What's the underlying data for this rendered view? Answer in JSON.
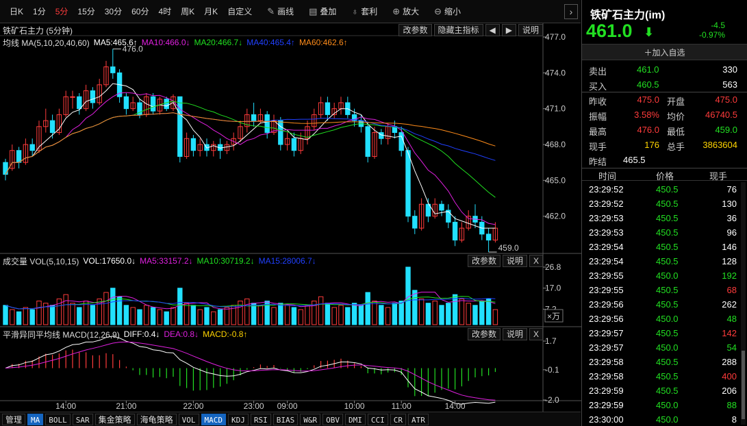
{
  "toolbar": {
    "periods": [
      "日K",
      "1分",
      "5分",
      "15分",
      "30分",
      "60分",
      "4时",
      "周K",
      "月K",
      "自定义"
    ],
    "active_period": "5分",
    "tools": [
      {
        "name": "draw",
        "icon": "pen-icon",
        "label": "画线"
      },
      {
        "name": "overlay",
        "icon": "stack-icon",
        "label": "叠加"
      },
      {
        "name": "arbitrage",
        "icon": "money-bag-icon",
        "label": "套利"
      },
      {
        "name": "zoom-in",
        "icon": "zoom-in-icon",
        "label": "放大"
      },
      {
        "name": "zoom-out",
        "icon": "zoom-out-icon",
        "label": "缩小"
      }
    ]
  },
  "main_panel": {
    "title": "铁矿石主力 (5分钟)",
    "ma_prefix": "均线 MA(5,10,20,40,60)",
    "ma_values": [
      {
        "label": "MA5:465.6↑",
        "color": "#ffffff"
      },
      {
        "label": "MA10:466.0↓",
        "color": "#e020e0"
      },
      {
        "label": "MA20:466.7↓",
        "color": "#20e020"
      },
      {
        "label": "MA40:465.4↑",
        "color": "#2040ff"
      },
      {
        "label": "MA60:462.6↑",
        "color": "#ff8c1a"
      }
    ],
    "buttons": [
      "改参数",
      "隐藏主指标",
      "◀",
      "▶",
      "说明"
    ],
    "y_ticks": [
      "477.0",
      "474.0",
      "471.0",
      "468.0",
      "465.0",
      "462.0"
    ],
    "high_label": "476.0",
    "low_label": "459.0"
  },
  "volume_panel": {
    "title": "成交量 VOL(5,10,15)",
    "values": [
      {
        "label": "VOL:17650.0↓",
        "color": "#ffffff"
      },
      {
        "label": "MA5:33157.2↓",
        "color": "#e020e0"
      },
      {
        "label": "MA10:30719.2↓",
        "color": "#20e020"
      },
      {
        "label": "MA15:28006.7↓",
        "color": "#2040ff"
      }
    ],
    "buttons": [
      "改参数",
      "说明",
      "X"
    ],
    "y_ticks": [
      "26.8",
      "17.0",
      "7.2"
    ],
    "unit": "×万"
  },
  "macd_panel": {
    "title": "平滑异同平均线 MACD(12,26,9)",
    "values": [
      {
        "label": "DIFF:0.4↓",
        "color": "#ffffff"
      },
      {
        "label": "DEA:0.8↓",
        "color": "#e020e0"
      },
      {
        "label": "MACD:-0.8↑",
        "color": "#ffd400"
      }
    ],
    "buttons": [
      "改参数",
      "说明",
      "X"
    ],
    "y_ticks": [
      "1.7",
      "-0.1",
      "-2.0"
    ]
  },
  "x_axis": [
    "14:00",
    "21:00",
    "22:00",
    "23:00",
    "09:00",
    "10:00",
    "11:00",
    "14:00"
  ],
  "bottom_tabs": [
    "管理",
    "MA",
    "BOLL",
    "SAR",
    "集金策略",
    "海龟策略",
    "VOL",
    "MACD",
    "KDJ",
    "RSI",
    "BIAS",
    "W&R",
    "OBV",
    "DMI",
    "CCI",
    "CR",
    "ATR"
  ],
  "active_tabs": [
    "MA",
    "MACD"
  ],
  "quote": {
    "name": "铁矿石主力(im)",
    "price": "461.0",
    "change": "-4.5",
    "change_pct": "-0.97%",
    "watch_label": "加入自选",
    "sell_label": "卖出",
    "sell_price": "461.0",
    "sell_vol": "330",
    "buy_label": "买入",
    "buy_price": "460.5",
    "buy_vol": "563",
    "prev_close_label": "昨收",
    "prev_close": "475.0",
    "open_label": "开盘",
    "open": "475.0",
    "amp_label": "振幅",
    "amp": "3.58%",
    "avg_label": "均价",
    "avg": "46740.5",
    "high_label": "最高",
    "high": "476.0",
    "low_label": "最低",
    "low": "459.0",
    "cur_vol_label": "现手",
    "cur_vol": "176",
    "total_vol_label": "总手",
    "total_vol": "3863604",
    "prev_settle_label": "昨结",
    "prev_settle": "465.5"
  },
  "ticks_header": [
    "时间",
    "价格",
    "现手"
  ],
  "ticks": [
    {
      "time": "23:29:52",
      "price": "450.5",
      "vol": "76",
      "vc": "w"
    },
    {
      "time": "23:29:52",
      "price": "450.5",
      "vol": "130",
      "vc": "w"
    },
    {
      "time": "23:29:53",
      "price": "450.5",
      "vol": "36",
      "vc": "w"
    },
    {
      "time": "23:29:53",
      "price": "450.5",
      "vol": "96",
      "vc": "w"
    },
    {
      "time": "23:29:54",
      "price": "450.5",
      "vol": "146",
      "vc": "w"
    },
    {
      "time": "23:29:54",
      "price": "450.5",
      "vol": "128",
      "vc": "w"
    },
    {
      "time": "23:29:55",
      "price": "450.0",
      "vol": "192",
      "vc": "g"
    },
    {
      "time": "23:29:55",
      "price": "450.5",
      "vol": "68",
      "vc": "r"
    },
    {
      "time": "23:29:56",
      "price": "450.5",
      "vol": "262",
      "vc": "w"
    },
    {
      "time": "23:29:56",
      "price": "450.0",
      "vol": "48",
      "vc": "g"
    },
    {
      "time": "23:29:57",
      "price": "450.5",
      "vol": "142",
      "vc": "r"
    },
    {
      "time": "23:29:57",
      "price": "450.0",
      "vol": "54",
      "vc": "g"
    },
    {
      "time": "23:29:58",
      "price": "450.5",
      "vol": "288",
      "vc": "w"
    },
    {
      "time": "23:29:58",
      "price": "450.5",
      "vol": "400",
      "vc": "r"
    },
    {
      "time": "23:29:59",
      "price": "450.5",
      "vol": "206",
      "vc": "w"
    },
    {
      "time": "23:29:59",
      "price": "450.0",
      "vol": "88",
      "vc": "g"
    },
    {
      "time": "23:30:00",
      "price": "450.0",
      "vol": "8",
      "vc": "w"
    }
  ],
  "chart_data": {
    "type": "candlestick",
    "title": "铁矿石主力 (5分钟)",
    "candles": [
      [
        466.5,
        465.5,
        466.8,
        465.0
      ],
      [
        466.0,
        467.5,
        468.0,
        465.8
      ],
      [
        467.5,
        466.5,
        467.8,
        466.0
      ],
      [
        466.5,
        468.0,
        468.5,
        466.3
      ],
      [
        468.0,
        467.5,
        468.5,
        467.0
      ],
      [
        467.5,
        469.5,
        470.0,
        467.3
      ],
      [
        469.5,
        470.0,
        471.0,
        469.0
      ],
      [
        470.0,
        469.0,
        470.5,
        468.5
      ],
      [
        469.0,
        470.5,
        471.0,
        468.8
      ],
      [
        470.5,
        472.0,
        472.5,
        470.3
      ],
      [
        472.0,
        472.0,
        472.5,
        471.0
      ],
      [
        472.0,
        471.0,
        472.3,
        470.5
      ],
      [
        471.0,
        472.5,
        473.0,
        470.8
      ],
      [
        472.5,
        471.5,
        472.8,
        471.0
      ],
      [
        471.5,
        473.0,
        473.5,
        471.3
      ],
      [
        473.0,
        474.5,
        475.0,
        472.8
      ],
      [
        474.5,
        474.0,
        476.0,
        473.5
      ],
      [
        474.0,
        472.0,
        474.3,
        471.5
      ],
      [
        472.0,
        471.0,
        472.3,
        470.5
      ],
      [
        471.0,
        471.5,
        472.0,
        470.8
      ],
      [
        471.5,
        470.5,
        471.8,
        470.2
      ],
      [
        470.5,
        472.0,
        472.3,
        470.3
      ],
      [
        472.0,
        470.8,
        472.3,
        470.5
      ],
      [
        470.8,
        471.8,
        472.0,
        470.5
      ],
      [
        471.8,
        471.0,
        472.0,
        470.8
      ],
      [
        471.0,
        472.0,
        472.2,
        470.8
      ],
      [
        472.0,
        467.0,
        472.0,
        466.5
      ],
      [
        467.0,
        468.5,
        469.0,
        466.8
      ],
      [
        468.5,
        467.5,
        468.8,
        467.0
      ],
      [
        467.5,
        468.0,
        468.5,
        467.0
      ],
      [
        468.0,
        467.5,
        468.5,
        467.0
      ],
      [
        467.5,
        468.0,
        468.3,
        467.0
      ],
      [
        468.0,
        467.5,
        468.5,
        466.8
      ],
      [
        467.5,
        468.0,
        468.3,
        467.2
      ],
      [
        468.0,
        468.5,
        469.0,
        467.5
      ],
      [
        468.5,
        469.5,
        470.0,
        468.2
      ],
      [
        469.5,
        470.5,
        471.0,
        469.0
      ],
      [
        470.5,
        470.0,
        471.5,
        469.5
      ],
      [
        470.0,
        470.5,
        471.0,
        469.8
      ],
      [
        470.5,
        469.0,
        470.8,
        468.5
      ],
      [
        469.0,
        470.0,
        470.5,
        468.8
      ],
      [
        470.0,
        468.0,
        470.3,
        467.5
      ],
      [
        468.0,
        468.5,
        469.0,
        467.5
      ],
      [
        468.5,
        467.5,
        469.0,
        467.0
      ],
      [
        467.5,
        468.5,
        469.0,
        467.2
      ],
      [
        468.5,
        469.5,
        470.0,
        468.0
      ],
      [
        469.5,
        470.5,
        471.0,
        469.2
      ],
      [
        470.5,
        471.5,
        472.0,
        470.2
      ],
      [
        471.5,
        470.5,
        472.0,
        470.0
      ],
      [
        470.5,
        471.0,
        471.5,
        470.2
      ],
      [
        471.0,
        471.5,
        472.0,
        470.5
      ],
      [
        471.5,
        470.5,
        472.0,
        470.2
      ],
      [
        470.5,
        470.0,
        471.0,
        469.5
      ],
      [
        470.0,
        469.5,
        470.5,
        469.0
      ],
      [
        469.5,
        467.0,
        469.8,
        466.5
      ],
      [
        467.0,
        469.0,
        469.5,
        466.8
      ],
      [
        469.0,
        468.5,
        469.3,
        468.0
      ],
      [
        468.5,
        469.5,
        469.8,
        468.0
      ],
      [
        469.5,
        469.0,
        470.0,
        468.5
      ],
      [
        469.0,
        467.5,
        469.5,
        467.0
      ],
      [
        467.5,
        462.0,
        467.8,
        461.5
      ],
      [
        462.0,
        461.0,
        462.5,
        460.5
      ],
      [
        461.0,
        463.0,
        463.5,
        460.8
      ],
      [
        463.0,
        462.0,
        463.5,
        461.5
      ],
      [
        462.0,
        463.0,
        463.5,
        461.8
      ],
      [
        463.0,
        462.5,
        463.3,
        462.0
      ],
      [
        462.5,
        461.5,
        463.0,
        461.0
      ],
      [
        461.5,
        460.0,
        462.0,
        459.5
      ],
      [
        460.0,
        461.0,
        461.5,
        459.8
      ],
      [
        461.0,
        462.0,
        462.5,
        460.8
      ],
      [
        462.0,
        461.5,
        463.0,
        461.0
      ],
      [
        461.5,
        460.5,
        462.0,
        460.0
      ],
      [
        460.5,
        460.0,
        461.0,
        459.0
      ],
      [
        460.0,
        461.0,
        461.5,
        459.8
      ]
    ],
    "volume": [
      9,
      7,
      6,
      8,
      7,
      11,
      10,
      9,
      12,
      14,
      10,
      8,
      11,
      9,
      12,
      15,
      17,
      13,
      9,
      8,
      7,
      9,
      8,
      7,
      6,
      8,
      17,
      10,
      9,
      7,
      8,
      6,
      7,
      8,
      9,
      11,
      12,
      10,
      9,
      11,
      8,
      10,
      9,
      8,
      7,
      9,
      11,
      13,
      10,
      8,
      9,
      8,
      10,
      9,
      15,
      11,
      9,
      8,
      10,
      11,
      26.8,
      16,
      12,
      10,
      11,
      9,
      10,
      14,
      12,
      10,
      9,
      11,
      12,
      7
    ],
    "ylim": [
      459.0,
      477.0
    ],
    "vol_ylim": [
      0,
      26.8
    ],
    "macd_ylim": [
      -2.0,
      1.7
    ]
  }
}
